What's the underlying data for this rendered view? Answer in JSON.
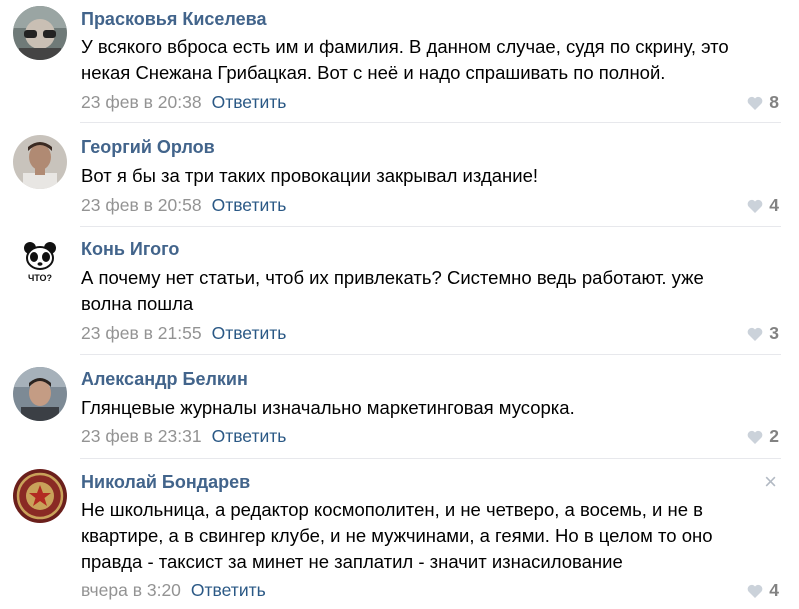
{
  "comments": [
    {
      "author": "Прасковья Киселева",
      "text_lines": [
        "У всякого вброса есть им и фамилия. В данном случае, судя по скрину, это",
        "некая Снежана Грибацкая. Вот с неё и надо спрашивать по полной."
      ],
      "date": "23 фев в 20:38",
      "reply": "Ответить",
      "likes": "8"
    },
    {
      "author": "Георгий Орлов",
      "text_lines": [
        "Вот я бы за три таких провокации закрывал издание!"
      ],
      "date": "23 фев в 20:58",
      "reply": "Ответить",
      "likes": "4"
    },
    {
      "author": "Конь Игого",
      "text_lines": [
        "А почему нет статьи, чтоб их привлекать? Системно ведь работают. уже",
        "волна пошла"
      ],
      "date": "23 фев в 21:55",
      "reply": "Ответить",
      "likes": "3",
      "avatar_text": "ЧТО?"
    },
    {
      "author": "Александр Белкин",
      "text_lines": [
        "Глянцевые журналы изначально маркетинговая мусорка."
      ],
      "date": "23 фев в 23:31",
      "reply": "Ответить",
      "likes": "2"
    },
    {
      "author": "Николай Бондарев",
      "text_lines": [
        "Не школьница, а редактор космополитен, и не четверо, а восемь, и не в",
        "квартире, а в свингер клубе, и не мужчинами, а геями. Но в целом то оно",
        "правда - таксист за минет не заплатил - значит изнасилование"
      ],
      "date": "вчера в 3:20",
      "reply": "Ответить",
      "likes": "4",
      "close_icon": "×"
    }
  ],
  "colors": {
    "author": "#42648b",
    "link": "#2a5885",
    "meta": "#939393",
    "likes": "#828282",
    "separator": "#e7e8ec"
  }
}
